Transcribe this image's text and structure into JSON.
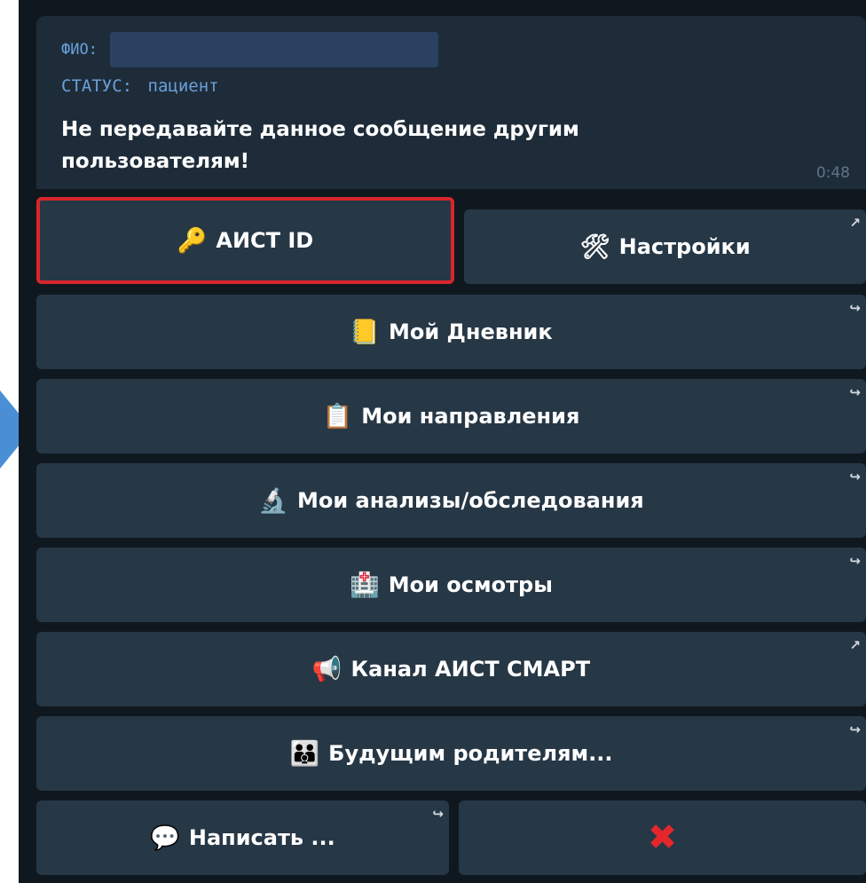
{
  "message": {
    "fio_label": "ФИО:",
    "status_label": "СТАТУС:",
    "status_value": "пациент",
    "warning": "Не передавайте данное сообщение другим пользователям!",
    "time": "0:48"
  },
  "keyboard": {
    "aist_id": {
      "icon": "🔑",
      "label": "АИСТ ID"
    },
    "settings": {
      "icon": "🛠",
      "label": "Настройки",
      "corner": "↗"
    },
    "diary": {
      "icon": "📒",
      "label": "Мой Дневник",
      "corner": "↪"
    },
    "referrals": {
      "icon": "📋",
      "label": "Мои направления",
      "corner": "↪"
    },
    "tests": {
      "icon": "🔬",
      "label": "Мои анализы/обследования",
      "corner": "↪"
    },
    "exams": {
      "icon": "🏥",
      "label": "Мои осмотры",
      "corner": "↪"
    },
    "channel": {
      "icon": "📢",
      "label": "Канал АИСТ СМАРТ",
      "corner": "↗"
    },
    "parents": {
      "icon": "👪",
      "label": "Будущим родителям...",
      "corner": "↪"
    },
    "write": {
      "icon": "💬",
      "label": "Написать ...",
      "corner": "↪"
    },
    "close": {
      "icon": "✖"
    }
  },
  "colors": {
    "background": "#10181f",
    "bubble": "#1e2c3a",
    "button": "#263746",
    "highlight": "#d7262b",
    "meta_text": "#6aa0d8"
  }
}
